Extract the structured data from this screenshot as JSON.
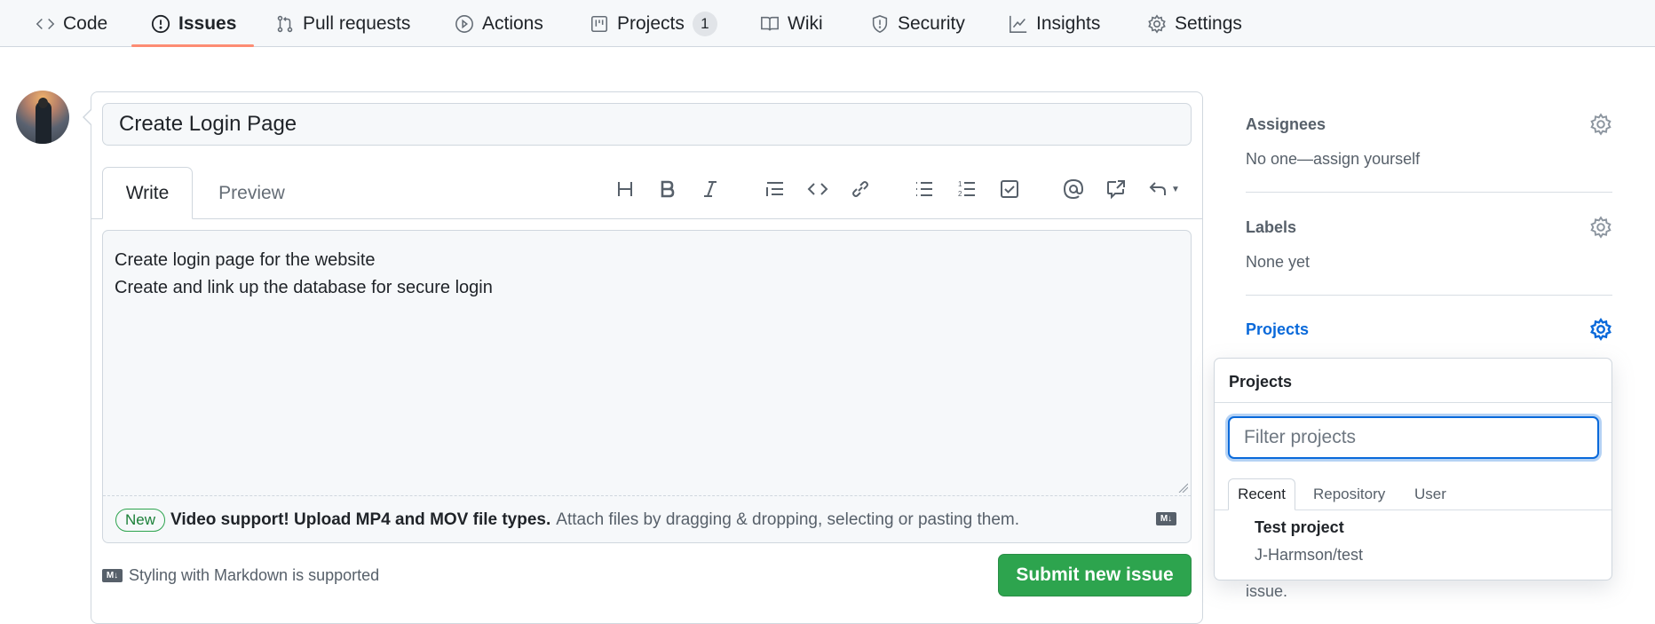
{
  "nav": {
    "items": [
      {
        "label": "Code",
        "icon": "code-icon"
      },
      {
        "label": "Issues",
        "icon": "issue-opened-icon",
        "active": true
      },
      {
        "label": "Pull requests",
        "icon": "git-pull-request-icon"
      },
      {
        "label": "Actions",
        "icon": "play-icon"
      },
      {
        "label": "Projects",
        "icon": "project-icon",
        "counter": "1"
      },
      {
        "label": "Wiki",
        "icon": "book-icon"
      },
      {
        "label": "Security",
        "icon": "shield-icon"
      },
      {
        "label": "Insights",
        "icon": "graph-icon"
      },
      {
        "label": "Settings",
        "icon": "gear-icon"
      }
    ],
    "active_color": "#fd8c73"
  },
  "issue_form": {
    "title_value": "Create Login Page",
    "tabs": {
      "write": "Write",
      "preview": "Preview"
    },
    "toolbar": [
      "heading-icon",
      "bold-icon",
      "italic-icon",
      "quote-icon",
      "code-icon",
      "link-icon",
      "unordered-list-icon",
      "ordered-list-icon",
      "task-list-icon",
      "mention-icon",
      "cross-reference-icon",
      "reply-icon"
    ],
    "body_value": "Create login page for the website\nCreate and link up the database for secure login",
    "attach": {
      "badge": "New",
      "bold": "Video support! Upload MP4 and MOV file types.",
      "text": "Attach files by dragging & dropping, selecting or pasting them."
    },
    "markdown_icon": "M↓",
    "markdown_note": "Styling with Markdown is supported",
    "submit_label": "Submit new issue",
    "submit_color": "#2da44e"
  },
  "sidebar": {
    "assignees": {
      "title": "Assignees",
      "value": "No one—assign yourself"
    },
    "labels": {
      "title": "Labels",
      "value": "None yet"
    },
    "projects": {
      "title": "Projects"
    },
    "trailing_text": "issue."
  },
  "projects_dropdown": {
    "header": "Projects",
    "filter_placeholder": "Filter projects",
    "filter_value": "",
    "tabs": [
      "Recent",
      "Repository",
      "User"
    ],
    "active_tab": "Recent",
    "items": [
      {
        "title": "Test project",
        "subtitle": "J-Harmson/test"
      }
    ]
  }
}
